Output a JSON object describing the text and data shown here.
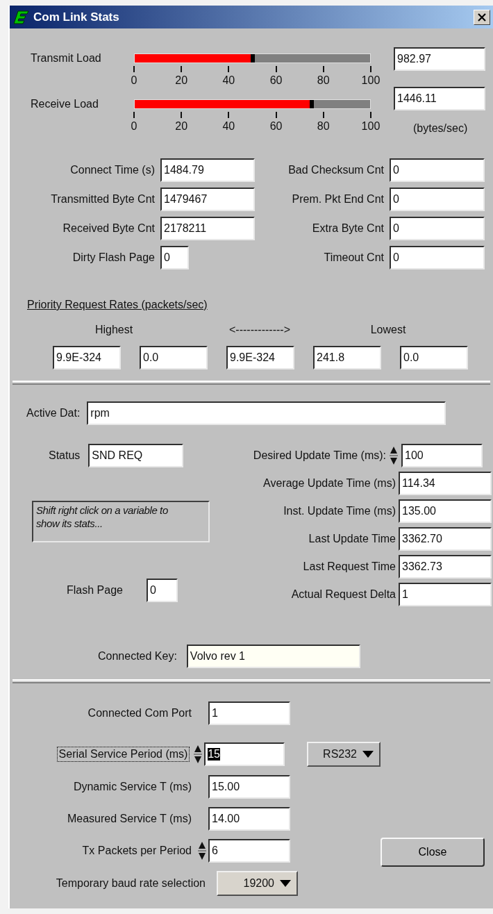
{
  "window": {
    "title": "Com Link Stats"
  },
  "loads": [
    {
      "label": "Transmit Load",
      "level": 0.51,
      "ticks": [
        "0",
        "20",
        "40",
        "60",
        "80",
        "100"
      ],
      "value": "982.97"
    },
    {
      "label": "Receive Load",
      "level": 0.76,
      "ticks": [
        "0",
        "20",
        "40",
        "60",
        "80",
        "100"
      ],
      "value": "1446.11"
    }
  ],
  "units": "(bytes/sec)",
  "counters_left": [
    {
      "label": "Connect Time (s)",
      "value": "1484.79",
      "kind": "wide"
    },
    {
      "label": "Transmitted Byte Cnt",
      "value": "1479467",
      "kind": "wide"
    },
    {
      "label": "Received Byte Cnt",
      "value": "2178211",
      "kind": "wide"
    },
    {
      "label": "Dirty Flash Page",
      "value": "0",
      "kind": "small"
    }
  ],
  "counters_right": [
    {
      "label": "Bad Checksum Cnt",
      "value": "0"
    },
    {
      "label": "Prem. Pkt End Cnt",
      "value": "0"
    },
    {
      "label": "Extra Byte Cnt",
      "value": "0"
    },
    {
      "label": "Timeout Cnt",
      "value": "0"
    }
  ],
  "priority": {
    "title": "Priority Request Rates (packets/sec)",
    "headings": [
      "Highest",
      "<------------->",
      "Lowest"
    ],
    "values": [
      "9.9E-324",
      "0.0",
      "9.9E-324",
      "241.8",
      "0.0"
    ]
  },
  "active_dat": {
    "label": "Active Dat:",
    "value": "rpm"
  },
  "status": {
    "label": "Status",
    "value": "SND REQ"
  },
  "hint": "Shift right click on a variable to show its stats...",
  "flash_page": {
    "label": "Flash Page",
    "value": "0"
  },
  "timing": [
    {
      "label": "Desired Update Time (ms):",
      "value": "100",
      "kind": "spinner"
    },
    {
      "label": "Average Update Time (ms)",
      "value": "114.34",
      "kind": "field"
    },
    {
      "label": "Inst. Update Time (ms)",
      "value": "135.00",
      "kind": "field"
    },
    {
      "label": "Last Update Time",
      "value": "3362.70",
      "kind": "field"
    },
    {
      "label": "Last Request Time",
      "value": "3362.73",
      "kind": "field"
    },
    {
      "label": "Actual Request Delta",
      "value": "1",
      "kind": "field"
    }
  ],
  "connected_key": {
    "label": "Connected Key:",
    "value": "Volvo rev 1"
  },
  "port": [
    {
      "label": "Connected Com Port",
      "value": "1",
      "kind": "field",
      "focused": false
    },
    {
      "label": "Serial Service Period (ms)",
      "value": "15",
      "kind": "spinner",
      "focused": true
    },
    {
      "label": "Dynamic Service T (ms)",
      "value": "15.00",
      "kind": "field",
      "focused": false
    },
    {
      "label": "Measured Service T (ms)",
      "value": "14.00",
      "kind": "field",
      "focused": false
    },
    {
      "label": "Tx Packets per Period",
      "value": "6",
      "kind": "spinner",
      "focused": false
    }
  ],
  "interface": "RS232",
  "close": "Close",
  "baud": {
    "label": "Temporary baud rate selection",
    "value": "19200"
  }
}
